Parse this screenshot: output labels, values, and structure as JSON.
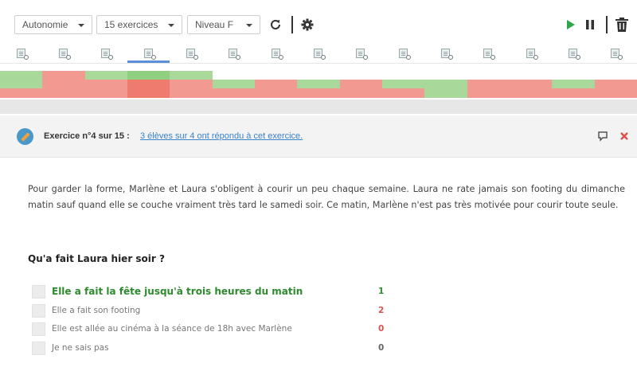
{
  "toolbar": {
    "mode_select": "Autonomie",
    "count_select": "15 exercices",
    "level_select": "Niveau F",
    "refresh_icon": "refresh-icon",
    "settings_icon": "gear-icon",
    "play_icon": "play-icon",
    "pause_icon": "pause-icon",
    "delete_icon": "trash-icon"
  },
  "grid": {
    "exercise_count": 15,
    "active_exercise": 4,
    "colors": {
      "green": "#a8d89a",
      "red": "#f29a92",
      "red_active": "#ef7a6e",
      "green_active": "#8fcf7f",
      "empty": "#ffffff"
    },
    "columns": [
      [
        "green",
        "green",
        "red"
      ],
      [
        "red",
        "red",
        "red"
      ],
      [
        "green",
        "red",
        "red"
      ],
      [
        "green_active",
        "red_active",
        "red_active"
      ],
      [
        "green",
        "red",
        "red"
      ],
      [
        "empty",
        "green",
        "red"
      ],
      [
        "empty",
        "red",
        "red"
      ],
      [
        "empty",
        "green",
        "red"
      ],
      [
        "empty",
        "red",
        "red"
      ],
      [
        "empty",
        "green",
        "red"
      ],
      [
        "empty",
        "green",
        "green"
      ],
      [
        "empty",
        "red",
        "red"
      ],
      [
        "empty",
        "red",
        "red"
      ],
      [
        "empty",
        "green",
        "red"
      ],
      [
        "empty",
        "red",
        "red"
      ]
    ]
  },
  "exercise": {
    "title": "Exercice n°4 sur 15",
    "separator": " : ",
    "responses_link": "3 élèves sur 4 ont répondu à cet exercice.",
    "comment_icon": "comment-icon",
    "close_icon": "close-icon",
    "text": "Pour garder la forme, Marlène et Laura s'obligent à courir un peu chaque semaine. Laura ne rate jamais son footing du dimanche matin sauf quand elle se couche vraiment très tard le samedi soir. Ce matin, Marlène n'est pas très motivée pour courir toute seule.",
    "question": "Qu'a fait Laura hier soir ?",
    "answers": [
      {
        "label": "Elle a fait la fête jusqu'à trois heures du matin",
        "count": "1",
        "correct": true,
        "count_color": "#2e8a2e"
      },
      {
        "label": "Elle a fait son footing",
        "count": "2",
        "correct": false,
        "count_color": "#d9534f"
      },
      {
        "label": "Elle est allée au cinéma à la séance de 18h avec Marlène",
        "count": "0",
        "correct": false,
        "count_color": "#d9534f"
      },
      {
        "label": "Je ne sais pas",
        "count": "0",
        "correct": false,
        "count_color": "#666666"
      }
    ]
  }
}
